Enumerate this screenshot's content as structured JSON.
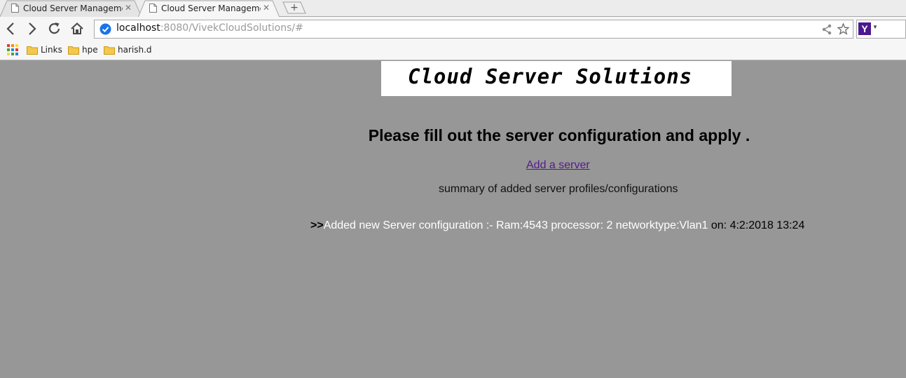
{
  "browser": {
    "tabs": [
      {
        "title": "Cloud Server Management",
        "active": false
      },
      {
        "title": "Cloud Server Management",
        "active": true
      }
    ],
    "new_tab_label": "+",
    "address": {
      "host": "localhost",
      "rest": ":8080/VivekCloudSolutions/#"
    },
    "extension_label": "Y",
    "bookmarks": [
      {
        "label": "Links"
      },
      {
        "label": "hpe"
      },
      {
        "label": "harish.d"
      }
    ]
  },
  "page": {
    "banner_text": "Cloud Server Solutions",
    "heading": "Please fill out the server configuration and apply .",
    "add_link": "Add a server",
    "summary": "summary of added server profiles/configurations",
    "entries": [
      {
        "marker": ">>",
        "message": "Added new Server configuration :- Ram:4543 processor: 2 networktype:Vlan1",
        "timestamp": " on: 4:2:2018 13:24"
      }
    ]
  },
  "colors": {
    "page_background": "#979797",
    "link": "#551a8b",
    "entry_text": "#ffffff"
  }
}
